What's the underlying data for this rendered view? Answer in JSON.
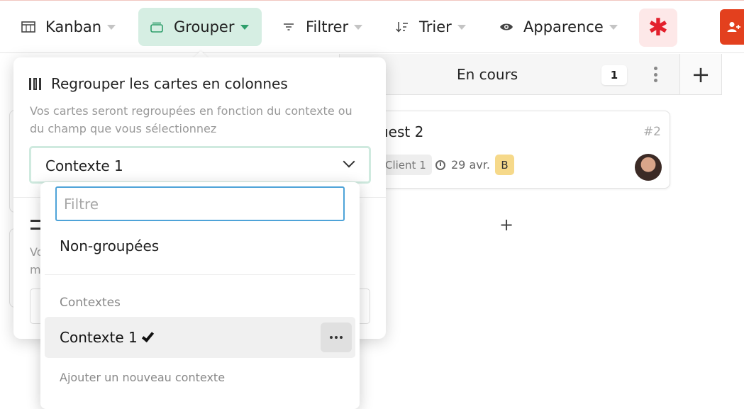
{
  "toolbar": {
    "kanban": "Kanban",
    "grouper": "Grouper",
    "filtrer": "Filtrer",
    "trier": "Trier",
    "apparence": "Apparence",
    "star_icon": "asterisk-icon",
    "adduser_icon": "add-user-icon"
  },
  "board": {
    "column_title": "En cours",
    "column_count": "1",
    "card": {
      "title": "uest 2",
      "id": "#2",
      "tag": "Client 1",
      "date": "29 avr.",
      "badge": "B"
    },
    "add": "+"
  },
  "popover": {
    "title": "Regrouper les cartes en colonnes",
    "description": "Vos cartes seront regroupées en fonction du contexte ou du champ que vous sélectionnez",
    "selected": "Contexte 1",
    "section2_text": "Vo\nm"
  },
  "dropdown": {
    "filter_placeholder": "Filtre",
    "non_grouped": "Non-groupées",
    "section_label": "Contextes",
    "item_label": "Contexte 1",
    "add_new": "Ajouter un nouveau contexte"
  },
  "colors": {
    "grouper_bg": "#d6eee3",
    "accent_green": "#2e9e6b",
    "star_red": "#e3202c",
    "adduser_bg": "#e3401e",
    "filter_border": "#4ea3d8",
    "badge_bg": "#f6d98a"
  }
}
